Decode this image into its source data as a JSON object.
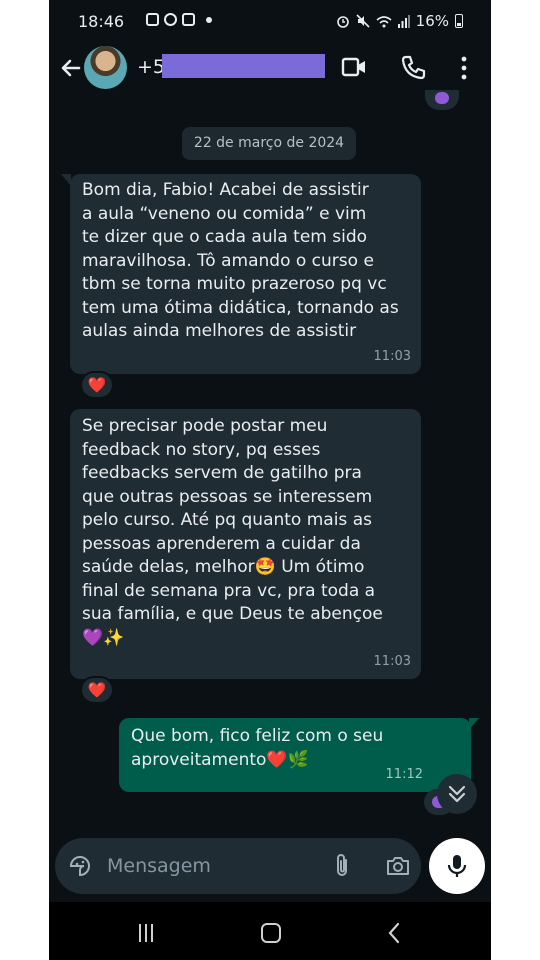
{
  "status_bar": {
    "time": "18:46",
    "battery": "16%",
    "left_icons": [
      "gallery-icon",
      "chrome-icon",
      "instagram-icon",
      "notification-dot"
    ],
    "right_icons": [
      "alarm-icon",
      "mute-icon",
      "wifi-icon",
      "signal-icon",
      "battery-icon"
    ]
  },
  "header": {
    "contact_prefix": "+5",
    "contact_redacted": true,
    "actions": [
      "video-call-icon",
      "phone-icon",
      "more-vert-icon"
    ]
  },
  "chat": {
    "date_chip": "22 de março de 2024",
    "messages": [
      {
        "direction": "incoming",
        "text": "Bom dia, Fabio! Acabei de assistir\na aula “veneno ou comida” e vim\nte dizer que o cada aula tem sido\nmaravilhosa. Tô amando o curso e\ntbm se torna muito prazeroso pq vc\ntem uma ótima didática, tornando as\naulas ainda melhores de assistir",
        "time": "11:03",
        "reaction": "❤️"
      },
      {
        "direction": "incoming",
        "text": "Se precisar pode postar meu\nfeedback no story, pq esses\nfeedbacks servem de gatilho pra\nque outras pessoas se interessem\npelo curso. Até pq quanto mais as\npessoas aprenderem a cuidar da\nsaúde delas, melhor🤩 Um ótimo\nfinal de semana pra vc, pra toda a\nsua família, e que Deus te abençoe\n💜✨",
        "time": "11:03",
        "reaction": "❤️"
      },
      {
        "direction": "outgoing",
        "text": "Que bom, fico feliz com o seu\naproveitamento❤️🌿",
        "time": "11:12"
      }
    ]
  },
  "composer": {
    "placeholder": "Mensagem",
    "icons": [
      "sticker-icon",
      "attach-icon",
      "camera-icon",
      "mic-icon"
    ]
  },
  "colors": {
    "background": "#0b1014",
    "incoming_bubble": "#1f2c33",
    "outgoing_bubble": "#005c4b",
    "text": "#e9edef"
  }
}
